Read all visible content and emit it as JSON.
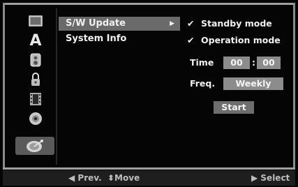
{
  "menu": {
    "items": [
      {
        "label": "S/W Update",
        "selected": true
      },
      {
        "label": "System Info",
        "selected": false
      }
    ],
    "arrow": "▶"
  },
  "icons": [
    "screen-icon",
    "language-icon",
    "audio-icon",
    "lock-icon",
    "film-icon",
    "disc-icon",
    "satellite-icon"
  ],
  "panel": {
    "standby": {
      "check": "✔",
      "label": "Standby mode"
    },
    "operation": {
      "check": "✔",
      "label": "Operation mode"
    },
    "time_label": "Time",
    "time_hours": "00",
    "time_sep": ":",
    "time_minutes": "00",
    "freq_label": "Freq.",
    "freq_value": "Weekly",
    "start_label": "Start"
  },
  "footer": {
    "prev": "◀ Prev.",
    "move": "⬍Move",
    "select": "▶ Select"
  },
  "colors": {
    "selected_bg": "#6a6a6a",
    "field_bg": "#8c8c8c",
    "footer_bg": "#1e1e1e"
  }
}
